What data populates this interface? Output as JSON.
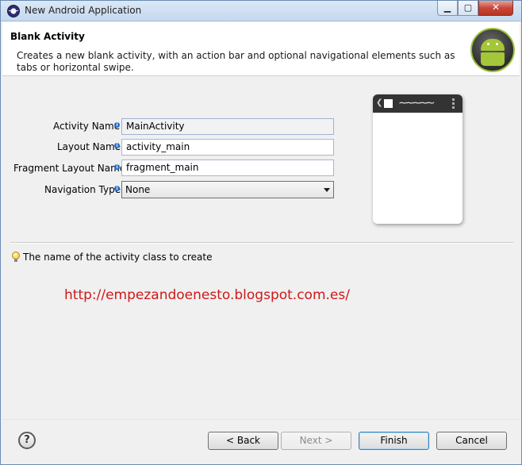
{
  "window": {
    "title": "New Android Application",
    "controls": {
      "minimize": "▁",
      "maximize": "▢",
      "close": "✕"
    }
  },
  "header": {
    "title": "Blank Activity",
    "description": "Creates a new blank activity, with an action bar and optional navigational elements such as tabs or horizontal swipe.",
    "logo_icon": "android-logo-icon"
  },
  "form": {
    "activity_name": {
      "label": "Activity Name",
      "value": "MainActivity"
    },
    "layout_name": {
      "label": "Layout Name",
      "value": "activity_main"
    },
    "fragment_layout_name": {
      "label": "Fragment Layout Name",
      "value": "fragment_main"
    },
    "navigation_type": {
      "label": "Navigation Type",
      "value": "None"
    },
    "info_icon": "i"
  },
  "preview": {
    "back_glyph": "❮",
    "wave_glyph": "∼∼∼∼∼"
  },
  "hint": {
    "text": "The name of the activity class to create",
    "icon": "lightbulb-icon"
  },
  "watermark": "http://empezandoenesto.blogspot.com.es/",
  "buttons": {
    "help": "?",
    "back": "< Back",
    "next": "Next >",
    "finish": "Finish",
    "cancel": "Cancel"
  },
  "colors": {
    "accent": "#a4c639",
    "watermark": "#d01818",
    "close": "#c8473a"
  }
}
